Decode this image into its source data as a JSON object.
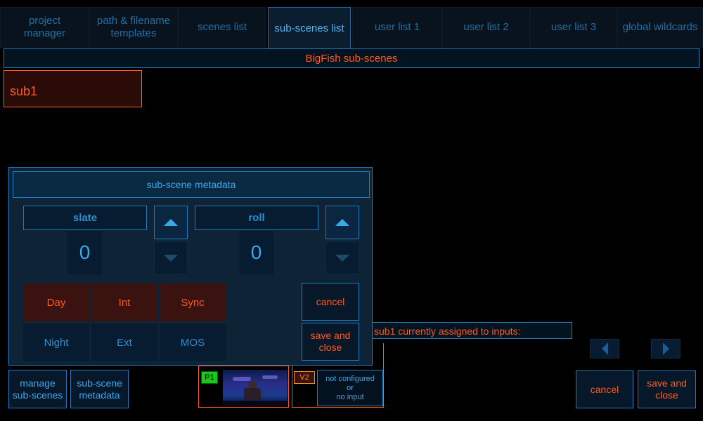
{
  "tabs": [
    {
      "label": "project\nmanager"
    },
    {
      "label": "path & filename\ntemplates"
    },
    {
      "label": "scenes list"
    },
    {
      "label": "sub-scenes list"
    },
    {
      "label": "user list 1"
    },
    {
      "label": "user list 2"
    },
    {
      "label": "user list 3"
    },
    {
      "label": "global wildcards"
    }
  ],
  "header": {
    "title": "BigFish sub-scenes"
  },
  "subscenes": [
    {
      "label": "sub1"
    }
  ],
  "dialog": {
    "title": "sub-scene metadata",
    "slate": {
      "label": "slate",
      "value": "0"
    },
    "roll": {
      "label": "roll",
      "value": "0"
    },
    "grid": [
      {
        "label": "Day",
        "state": "on"
      },
      {
        "label": "Int",
        "state": "on"
      },
      {
        "label": "Sync",
        "state": "on"
      },
      {
        "label": "Night",
        "state": "off"
      },
      {
        "label": "Ext",
        "state": "off"
      },
      {
        "label": "MOS",
        "state": "off"
      }
    ],
    "cancel_label": "cancel",
    "save_label": "save and\nclose"
  },
  "assigned": {
    "text": "sub1 currently assigned to inputs:"
  },
  "inputs": {
    "p1": {
      "badge": "P1"
    },
    "v2": {
      "badge": "V2",
      "status": "not configured\nor\nno input"
    }
  },
  "footer": {
    "manage_label": "manage\nsub-scenes",
    "metadata_label": "sub-scene\nmetadata",
    "cancel_label": "cancel",
    "save_label": "save and\nclose"
  },
  "colors": {
    "accent_blue": "#2a8fd0",
    "accent_orange": "#ff5a1f",
    "border_blue": "#1f7bbd"
  }
}
